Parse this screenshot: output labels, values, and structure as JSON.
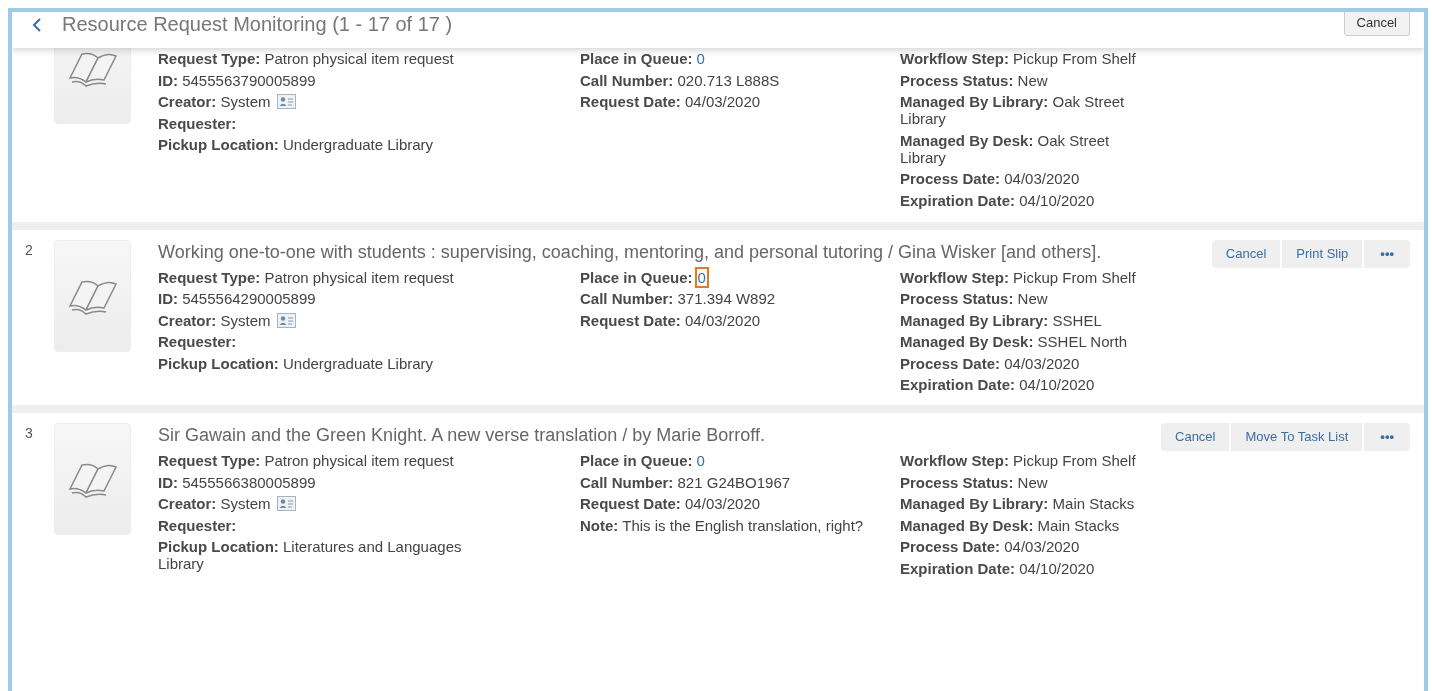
{
  "header": {
    "title": "Resource Request Monitoring (1 - 17 of 17 )",
    "cancel": "Cancel"
  },
  "requests": [
    {
      "columns": [
        [
          {
            "kind": "text",
            "label": "Request Type:",
            "value": "Patron physical item request"
          },
          {
            "kind": "text",
            "label": "ID:",
            "value": "5455563790005899"
          },
          {
            "kind": "person",
            "label": "Creator:",
            "value": "System"
          },
          {
            "kind": "text",
            "label": "Requester:"
          },
          {
            "kind": "text",
            "label": "Pickup Location:",
            "value": "Undergraduate Library"
          }
        ],
        [
          {
            "kind": "link",
            "label": "Place in Queue:",
            "value": "0",
            "focused": false
          },
          {
            "kind": "text",
            "label": "Call Number:",
            "value": "020.713 L888S"
          },
          {
            "kind": "text",
            "label": "Request Date:",
            "value": "04/03/2020"
          }
        ],
        [
          {
            "kind": "text",
            "label": "Workflow Step:",
            "value": "Pickup From Shelf"
          },
          {
            "kind": "text",
            "label": "Process Status:",
            "value": "New"
          },
          {
            "kind": "text",
            "label": "Managed By Library:",
            "value": "Oak Street Library"
          },
          {
            "kind": "text",
            "label": "Managed By Desk:",
            "value": "Oak Street Library"
          },
          {
            "kind": "text",
            "label": "Process Date:",
            "value": "04/03/2020"
          },
          {
            "kind": "text",
            "label": "Expiration Date:",
            "value": "04/10/2020"
          }
        ]
      ]
    },
    {
      "number": "2",
      "title": "Working one-to-one with students : supervising, coaching, mentoring, and personal tutoring / Gina Wisker [and others].",
      "actions": [
        "Cancel",
        "Print Slip",
        "•••"
      ],
      "columns": [
        [
          {
            "kind": "text",
            "label": "Request Type:",
            "value": "Patron physical item request"
          },
          {
            "kind": "text",
            "label": "ID:",
            "value": "5455564290005899"
          },
          {
            "kind": "person",
            "label": "Creator:",
            "value": "System"
          },
          {
            "kind": "text",
            "label": "Requester:"
          },
          {
            "kind": "text",
            "label": "Pickup Location:",
            "value": "Undergraduate Library"
          }
        ],
        [
          {
            "kind": "link",
            "label": "Place in Queue:",
            "value": "0",
            "focused": true
          },
          {
            "kind": "text",
            "label": "Call Number:",
            "value": "371.394 W892"
          },
          {
            "kind": "text",
            "label": "Request Date:",
            "value": "04/03/2020"
          }
        ],
        [
          {
            "kind": "text",
            "label": "Workflow Step:",
            "value": "Pickup From Shelf"
          },
          {
            "kind": "text",
            "label": "Process Status:",
            "value": "New"
          },
          {
            "kind": "text",
            "label": "Managed By Library:",
            "value": "SSHEL"
          },
          {
            "kind": "text",
            "label": "Managed By Desk:",
            "value": "SSHEL North"
          },
          {
            "kind": "text",
            "label": "Process Date:",
            "value": "04/03/2020"
          },
          {
            "kind": "text",
            "label": "Expiration Date:",
            "value": "04/10/2020"
          }
        ]
      ]
    },
    {
      "number": "3",
      "title": "Sir Gawain and the Green Knight. A new verse translation / by Marie Borroff.",
      "actions": [
        "Cancel",
        "Move To Task List",
        "•••"
      ],
      "columns": [
        [
          {
            "kind": "text",
            "label": "Request Type:",
            "value": "Patron physical item request"
          },
          {
            "kind": "text",
            "label": "ID:",
            "value": "5455566380005899"
          },
          {
            "kind": "person",
            "label": "Creator:",
            "value": "System"
          },
          {
            "kind": "text",
            "label": "Requester:"
          },
          {
            "kind": "text",
            "label": "Pickup Location:",
            "value": "Literatures and Languages Library"
          }
        ],
        [
          {
            "kind": "link",
            "label": "Place in Queue:",
            "value": "0",
            "focused": false
          },
          {
            "kind": "text",
            "label": "Call Number:",
            "value": "821 G24BO1967"
          },
          {
            "kind": "text",
            "label": "Request Date:",
            "value": "04/03/2020"
          },
          {
            "kind": "text",
            "label": "Note:",
            "value": "This is the English translation, right?"
          }
        ],
        [
          {
            "kind": "text",
            "label": "Workflow Step:",
            "value": "Pickup From Shelf"
          },
          {
            "kind": "text",
            "label": "Process Status:",
            "value": "New"
          },
          {
            "kind": "text",
            "label": "Managed By Library:",
            "value": "Main Stacks"
          },
          {
            "kind": "text",
            "label": "Managed By Desk:",
            "value": "Main Stacks"
          },
          {
            "kind": "text",
            "label": "Process Date:",
            "value": "04/03/2020"
          },
          {
            "kind": "text",
            "label": "Expiration Date:",
            "value": "04/10/2020"
          }
        ]
      ]
    }
  ]
}
